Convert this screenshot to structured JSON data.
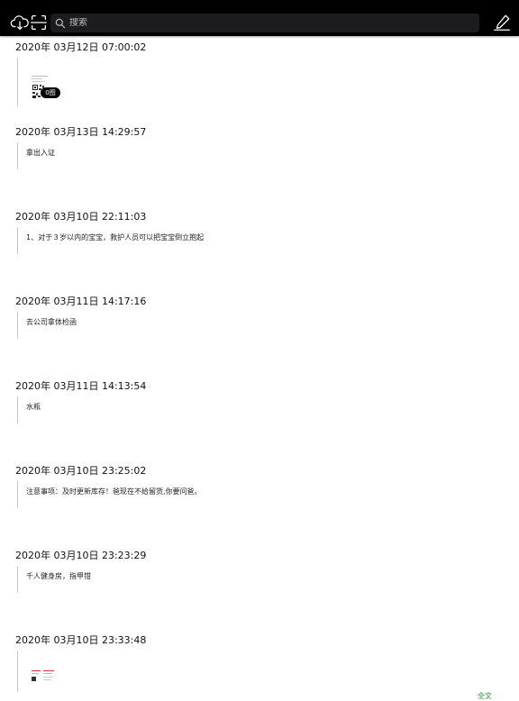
{
  "toolbar": {
    "sync_icon": "cloud-sync-icon",
    "scan_icon": "scan-icon",
    "compose_icon": "pen-icon",
    "search_placeholder": "搜索"
  },
  "entries": [
    {
      "date": "2020年 03月12日 07:00:02",
      "type": "image",
      "badge": "0图"
    },
    {
      "date": "2020年 03月13日 14:29:57",
      "type": "text",
      "text": "拿出入证"
    },
    {
      "date": "2020年 03月10日 22:11:03",
      "type": "text",
      "text": "1、对于３岁以内的宝宝，救护人员可以把宝宝倒立抱起"
    },
    {
      "date": "2020年 03月11日 14:17:16",
      "type": "text",
      "text": "去公司拿体检函"
    },
    {
      "date": "2020年 03月11日 14:13:54",
      "type": "text",
      "text": "水瓶"
    },
    {
      "date": "2020年 03月10日 23:25:02",
      "type": "text",
      "text": "注意事项：及时更新库存！爸现在不给留货,你要问爸。"
    },
    {
      "date": "2020年 03月10日 23:23:29",
      "type": "text",
      "text": "千人健身房，指甲钳"
    },
    {
      "date": "2020年 03月10日 23:33:48",
      "type": "image",
      "badge": ""
    }
  ],
  "full_text_link": "全文",
  "colors": {
    "topbar": "#000000",
    "link_green": "#2e8b3a"
  }
}
